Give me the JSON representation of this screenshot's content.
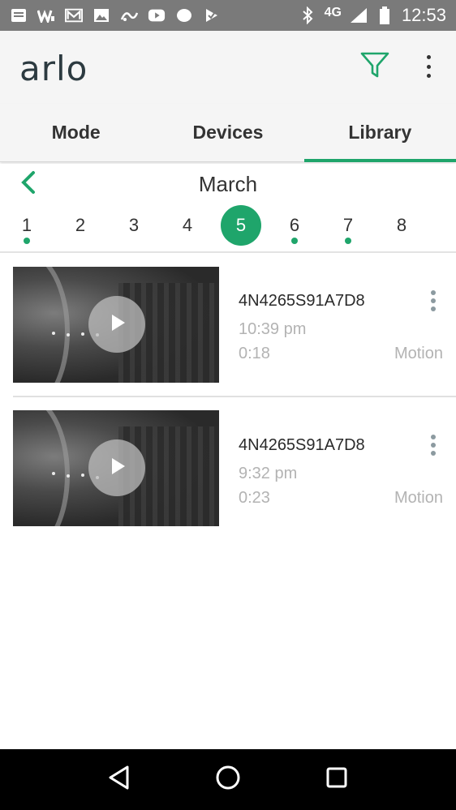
{
  "status_bar": {
    "network": "4G",
    "time": "12:53",
    "icons": [
      "notes-icon",
      "w-app-icon",
      "mail-icon",
      "image-icon",
      "signal-app-icon",
      "youtube-icon",
      "circle-icon",
      "check-app-icon",
      "bluetooth-icon",
      "cell-signal-icon",
      "battery-icon"
    ]
  },
  "app_bar": {
    "logo": "arlo",
    "accent_color": "#1fa56b"
  },
  "tabs": [
    {
      "label": "Mode",
      "active": false
    },
    {
      "label": "Devices",
      "active": false
    },
    {
      "label": "Library",
      "active": true
    }
  ],
  "calendar": {
    "month": "March",
    "days": [
      {
        "label": "1",
        "has_recordings": true,
        "selected": false
      },
      {
        "label": "2",
        "has_recordings": false,
        "selected": false
      },
      {
        "label": "3",
        "has_recordings": false,
        "selected": false
      },
      {
        "label": "4",
        "has_recordings": false,
        "selected": false
      },
      {
        "label": "5",
        "has_recordings": false,
        "selected": true
      },
      {
        "label": "6",
        "has_recordings": true,
        "selected": false
      },
      {
        "label": "7",
        "has_recordings": true,
        "selected": false
      },
      {
        "label": "8",
        "has_recordings": false,
        "selected": false
      }
    ]
  },
  "recordings": [
    {
      "device": "4N4265S91A7D8",
      "time": "10:39 pm",
      "duration": "0:18",
      "trigger": "Motion"
    },
    {
      "device": "4N4265S91A7D8",
      "time": "9:32 pm",
      "duration": "0:23",
      "trigger": "Motion"
    }
  ]
}
